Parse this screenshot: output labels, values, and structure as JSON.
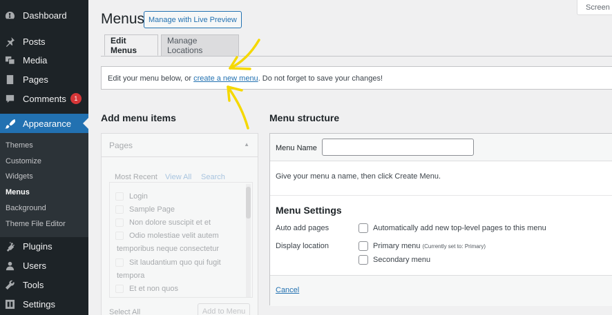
{
  "sidebar": {
    "items": [
      {
        "label": "Dashboard",
        "icon": "dashboard-icon"
      },
      {
        "label": "Posts",
        "icon": "pin-icon"
      },
      {
        "label": "Media",
        "icon": "media-icon"
      },
      {
        "label": "Pages",
        "icon": "pages-icon"
      },
      {
        "label": "Comments",
        "icon": "comment-icon",
        "badge": "1"
      },
      {
        "label": "Appearance",
        "icon": "paintbrush-icon"
      },
      {
        "label": "Plugins",
        "icon": "plugin-icon"
      },
      {
        "label": "Users",
        "icon": "users-icon"
      },
      {
        "label": "Tools",
        "icon": "wrench-icon"
      },
      {
        "label": "Settings",
        "icon": "settings-icon"
      }
    ],
    "submenu": [
      "Themes",
      "Customize",
      "Widgets",
      "Menus",
      "Background",
      "Theme File Editor"
    ],
    "active": "Appearance",
    "current_sub": "Menus"
  },
  "header": {
    "title": "Menus",
    "live_preview_label": "Manage with Live Preview",
    "screen_options": "Screen Options"
  },
  "tabs": {
    "edit": "Edit Menus",
    "locations": "Manage Locations"
  },
  "notice": {
    "before": "Edit your menu below, or ",
    "link": "create a new menu",
    "after": ". Do not forget to save your changes!"
  },
  "add_items": {
    "title": "Add menu items",
    "box_title": "Pages",
    "tabs": [
      "Most Recent",
      "View All",
      "Search"
    ],
    "pages": [
      "Login",
      "Sample Page",
      "Non dolore suscipit et et",
      "Odio molestiae velit autem",
      "temporibus neque consectetur",
      "Sit laudantium quo qui fugit",
      "tempora",
      "Et et non quos"
    ],
    "select_all": "Select All",
    "add_button": "Add to Menu"
  },
  "structure": {
    "title": "Menu structure",
    "menu_name_label": "Menu Name",
    "menu_name_value": "",
    "hint": "Give your menu a name, then click Create Menu.",
    "settings_title": "Menu Settings",
    "auto_add_label": "Auto add pages",
    "auto_add_option": "Automatically add new top-level pages to this menu",
    "display_location_label": "Display location",
    "primary_menu": "Primary menu",
    "primary_note": "(Currently set to: Primary)",
    "secondary_menu": "Secondary menu",
    "cancel": "Cancel"
  },
  "colors": {
    "sidebar_bg": "#1d2327",
    "accent": "#2271b1",
    "badge": "#d63638",
    "annotation": "#f5d800"
  }
}
